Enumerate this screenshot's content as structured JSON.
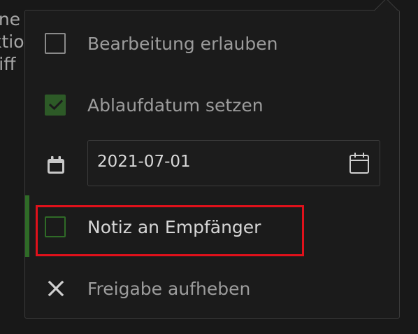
{
  "background_text": [
    "rne",
    "ktio",
    "riff"
  ],
  "menu": {
    "allow_editing": {
      "label": "Bearbeitung erlauben",
      "checked": false
    },
    "set_expiration": {
      "label": "Ablaufdatum setzen",
      "checked": true
    },
    "expiration_date": {
      "value": "2021-07-01"
    },
    "note_to_recipient": {
      "label": "Notiz an Empfänger",
      "checked": false,
      "focused": true
    },
    "unshare": {
      "label": "Freigabe aufheben"
    }
  },
  "colors": {
    "accent_green": "#2d5a27",
    "highlight_red": "#e0111b",
    "background": "#181818"
  },
  "icons": {
    "checkmark": "check-icon",
    "calendar_leading": "calendar-icon",
    "calendar_picker": "calendar-picker-icon",
    "close": "close-icon"
  }
}
